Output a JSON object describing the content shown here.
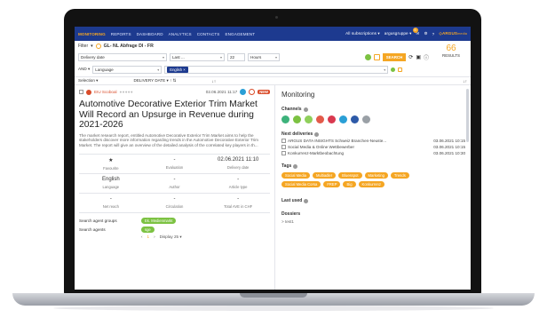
{
  "nav": {
    "items": [
      "MONITORING",
      "REPORTS",
      "DASHBOARD",
      "ANALYTICS",
      "CONTACTS",
      "ENGAGEMENT"
    ],
    "active": "MONITORING",
    "subscriptions": "All subscriptions",
    "user": "argusgruppe",
    "notifications": "5",
    "brand": "ARGUS",
    "brand_sub": "media"
  },
  "filter": {
    "label": "Filter",
    "title": "GL- NL Abfrage DI - FR",
    "date_field": "Delivery date",
    "range": "Last ...",
    "amount": "22",
    "unit": "Hours",
    "operator": "AND",
    "language_field": "Language",
    "language_value": "English ×",
    "search_label": "SEARCH"
  },
  "results": {
    "count": "66",
    "label": "RESULTS"
  },
  "list_header": {
    "selection": "Selection",
    "sort": "DELIVERY DATE"
  },
  "article": {
    "source": "EIU Scoboal",
    "rating": "●●●●●",
    "date": "02.06.2021 11:17",
    "badge": "NEW",
    "headline": "Automotive Decorative Exterior Trim Market Will Record an Upsurge in Revenue during 2021-2026",
    "body": "The market research report, entitled Automotive Decorative Exterior Trim Market aims to help the stakeholders discover more information regarding trends in the Automotive Decorative Exterior Trim Market. The report will give an overview of the detailed analysis of the correlated key players in th...",
    "cells": [
      {
        "value": "★",
        "label": "Favourite"
      },
      {
        "value": "-",
        "label": "Evaluation"
      },
      {
        "value": "02.06.2021 11:10",
        "label": "Delivery date"
      },
      {
        "value": "English",
        "label": "Language"
      },
      {
        "value": "-",
        "label": "Author"
      },
      {
        "value": "-",
        "label": "Article type"
      },
      {
        "value": "-",
        "label": "Net reach"
      },
      {
        "value": "-",
        "label": "Circulation"
      },
      {
        "value": "-",
        "label": "Total AVE in CHF"
      }
    ],
    "agent_groups_label": "Search agent groups",
    "agent_groups_value": "Ek. Medienmarkt",
    "agents_label": "Search agents",
    "agents_value": "sge",
    "pager_page": "1",
    "pager_display": "Display 25"
  },
  "monitoring": {
    "title": "Monitoring",
    "channels_label": "Channels",
    "channel_colors": [
      "#3db27b",
      "#7cc242",
      "#8fcf5a",
      "#e35a4a",
      "#d9394f",
      "#2a9fd6",
      "#2d5aa8",
      "#9aa0a6"
    ],
    "deliveries_label": "Next deliveries",
    "deliveries": [
      {
        "name": "ARGUS DATA INSIGHTS Schweiz Branchen-Neuste...",
        "time": "03.06.2021 10:15"
      },
      {
        "name": "Social Media & Online Wettbewerber",
        "time": "03.06.2021 10:15"
      },
      {
        "name": "Konkurrenz-Marktbeobachtung",
        "time": "03.06.2021 10:30"
      }
    ],
    "tags_label": "Tags",
    "tags": [
      "Social Media",
      "Multiadler",
      "Bluesspot",
      "Marketing",
      "Trends",
      "Social Media Corsa",
      "FREP",
      "Big",
      "Konkurrenz"
    ],
    "last_used_label": "Last used",
    "dossiers_label": "Dossiers",
    "dossier_item": "> test1"
  }
}
